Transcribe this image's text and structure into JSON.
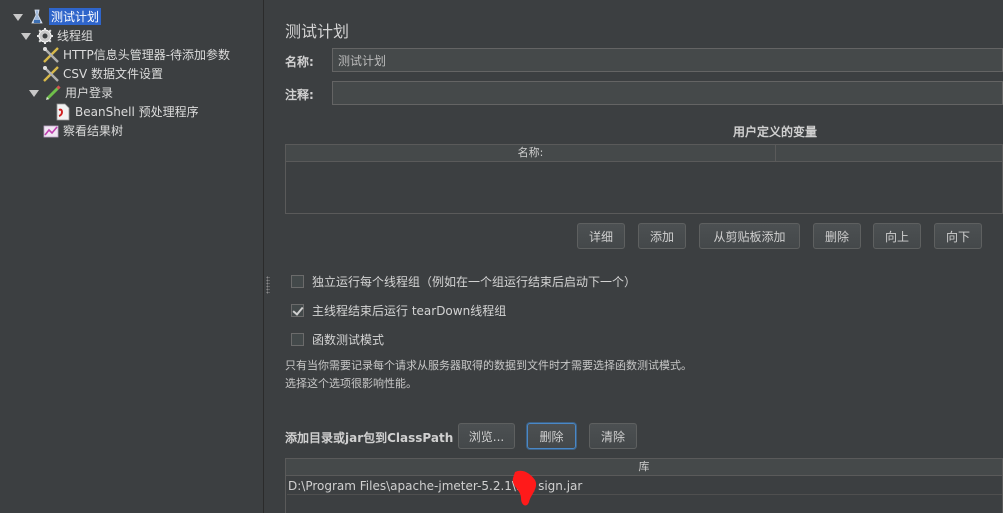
{
  "tree": {
    "items": [
      {
        "label": "测试计划",
        "icon": "test-plan-icon",
        "selected": true
      },
      {
        "label": "线程组",
        "icon": "gear-icon"
      },
      {
        "label": "HTTP信息头管理器-待添加参数",
        "icon": "wrench-icon"
      },
      {
        "label": "CSV 数据文件设置",
        "icon": "wrench-icon"
      },
      {
        "label": "用户登录",
        "icon": "pen-icon"
      },
      {
        "label": "BeanShell 预处理程序",
        "icon": "document-icon"
      },
      {
        "label": "察看结果树",
        "icon": "chart-icon"
      }
    ]
  },
  "main": {
    "title": "测试计划",
    "name_label": "名称:",
    "name_value": "测试计划",
    "comment_label": "注释:",
    "comment_value": "",
    "variables_title": "用户定义的变量",
    "variables_table": {
      "columns": [
        "名称:"
      ]
    },
    "variable_buttons": {
      "detail": "详细",
      "add": "添加",
      "add_from_clipboard": "从剪贴板添加",
      "delete": "删除",
      "up": "向上",
      "down": "向下"
    },
    "options": [
      {
        "label": "独立运行每个线程组（例如在一个组运行结束后启动下一个）",
        "checked": false
      },
      {
        "label": "主线程结束后运行 tearDown线程组",
        "checked": true
      },
      {
        "label": "函数测试模式",
        "checked": false
      }
    ],
    "functional_note_line1": "只有当你需要记录每个请求从服务器取得的数据到文件时才需要选择函数测试模式。",
    "functional_note_line2": "选择这个选项很影响性能。",
    "classpath_label": "添加目录或jar包到ClassPath",
    "classpath_buttons": {
      "browse": "浏览...",
      "delete": "删除",
      "clear": "清除"
    },
    "library_table": {
      "column": "库",
      "rows": [
        "D:\\Program Files\\apache-jmeter-5.2.1\\lib\\   sign.jar"
      ]
    }
  },
  "colors": {
    "background": "#3c3f41",
    "selection": "#2f65ca",
    "redaction": "#ff0000"
  }
}
